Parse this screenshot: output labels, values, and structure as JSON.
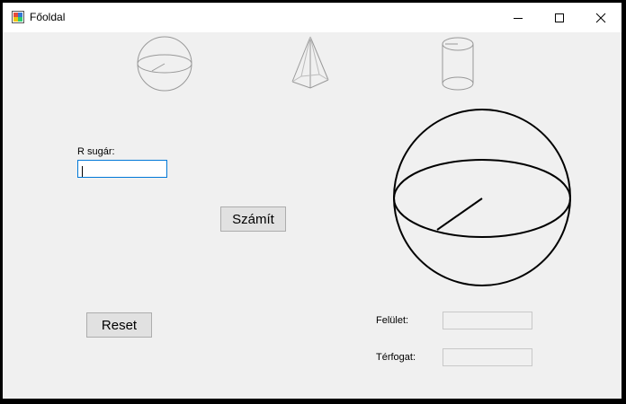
{
  "window": {
    "title": "Főoldal"
  },
  "shapes": [
    {
      "icon": "sphere-icon"
    },
    {
      "icon": "pyramid-icon"
    },
    {
      "icon": "cylinder-icon"
    }
  ],
  "form": {
    "radius_label": "R sugár:",
    "radius_value": "",
    "calculate_label": "Számít",
    "reset_label": "Reset",
    "surface_label": "Felület:",
    "surface_value": "",
    "volume_label": "Térfogat:",
    "volume_value": ""
  },
  "preview": {
    "icon": "sphere-diagram"
  }
}
